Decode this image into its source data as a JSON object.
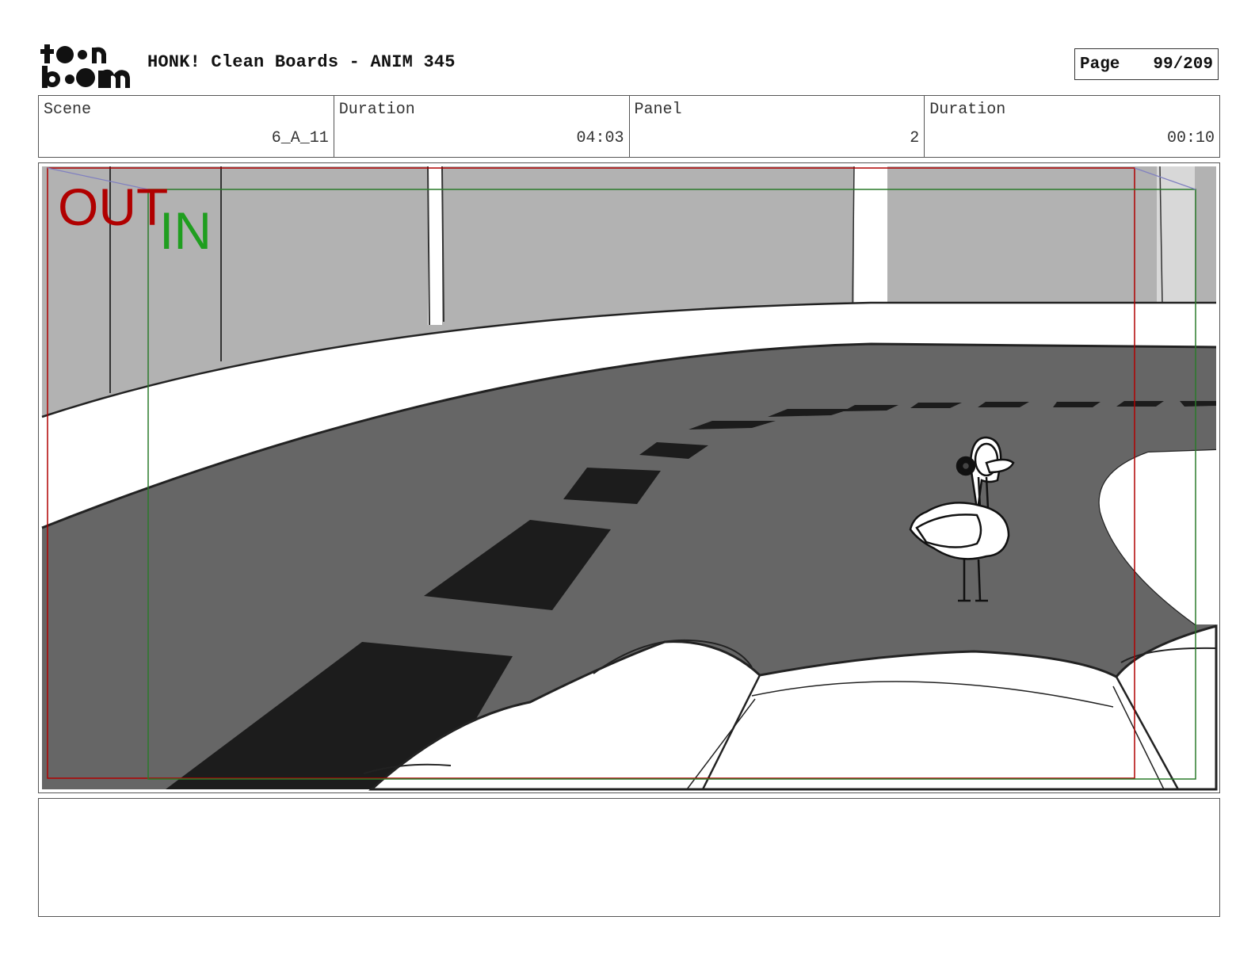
{
  "header": {
    "logo_text": "toon boom",
    "title": "HONK! Clean Boards - ANIM 345",
    "page_label": "Page",
    "page_value": "99/209"
  },
  "info": [
    {
      "label": "Scene",
      "value": "6_A_11"
    },
    {
      "label": "Duration",
      "value": "04:03"
    },
    {
      "label": "Panel",
      "value": "2"
    },
    {
      "label": "Duration",
      "value": "00:10"
    }
  ],
  "panel": {
    "out_label": "OUT",
    "in_label": "IN",
    "out_color": "#b00000",
    "in_color": "#1f9e1f",
    "guide_green": "#2a7a2a",
    "road_color": "#666666",
    "wall_color": "#b2b2b2"
  },
  "notes": {
    "text": ""
  }
}
